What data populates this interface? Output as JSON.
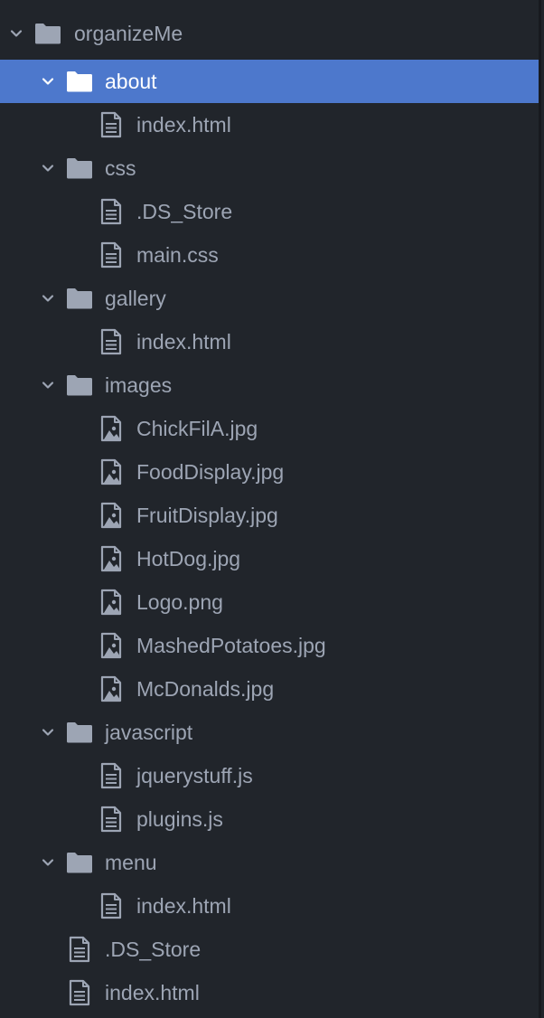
{
  "tree": {
    "root": {
      "label": "organizeMe"
    },
    "rows": [
      {
        "label": "about",
        "kind": "folder",
        "depth": 1,
        "expanded": true,
        "selected": true
      },
      {
        "label": "index.html",
        "kind": "file",
        "depth": 2
      },
      {
        "label": "css",
        "kind": "folder",
        "depth": 1,
        "expanded": true
      },
      {
        "label": ".DS_Store",
        "kind": "file",
        "depth": 2
      },
      {
        "label": "main.css",
        "kind": "file",
        "depth": 2
      },
      {
        "label": "gallery",
        "kind": "folder",
        "depth": 1,
        "expanded": true
      },
      {
        "label": "index.html",
        "kind": "file",
        "depth": 2
      },
      {
        "label": "images",
        "kind": "folder",
        "depth": 1,
        "expanded": true
      },
      {
        "label": "ChickFilA.jpg",
        "kind": "image",
        "depth": 2
      },
      {
        "label": "FoodDisplay.jpg",
        "kind": "image",
        "depth": 2
      },
      {
        "label": "FruitDisplay.jpg",
        "kind": "image",
        "depth": 2
      },
      {
        "label": "HotDog.jpg",
        "kind": "image",
        "depth": 2
      },
      {
        "label": "Logo.png",
        "kind": "image",
        "depth": 2
      },
      {
        "label": "MashedPotatoes.jpg",
        "kind": "image",
        "depth": 2
      },
      {
        "label": "McDonalds.jpg",
        "kind": "image",
        "depth": 2
      },
      {
        "label": "javascript",
        "kind": "folder",
        "depth": 1,
        "expanded": true
      },
      {
        "label": "jquerystuff.js",
        "kind": "file",
        "depth": 2
      },
      {
        "label": "plugins.js",
        "kind": "file",
        "depth": 2
      },
      {
        "label": "menu",
        "kind": "folder",
        "depth": 1,
        "expanded": true
      },
      {
        "label": "index.html",
        "kind": "file",
        "depth": 2
      },
      {
        "label": ".DS_Store",
        "kind": "file",
        "depth": 1
      },
      {
        "label": "index.html",
        "kind": "file",
        "depth": 1
      }
    ]
  },
  "icons": {
    "folder": "folder-icon",
    "file": "file-text-icon",
    "image": "file-image-icon",
    "chevron": "chevron-down-icon"
  },
  "colors": {
    "background": "#21252b",
    "selection": "#4d78cc",
    "text": "#9da5b4",
    "selected_text": "#ffffff"
  }
}
